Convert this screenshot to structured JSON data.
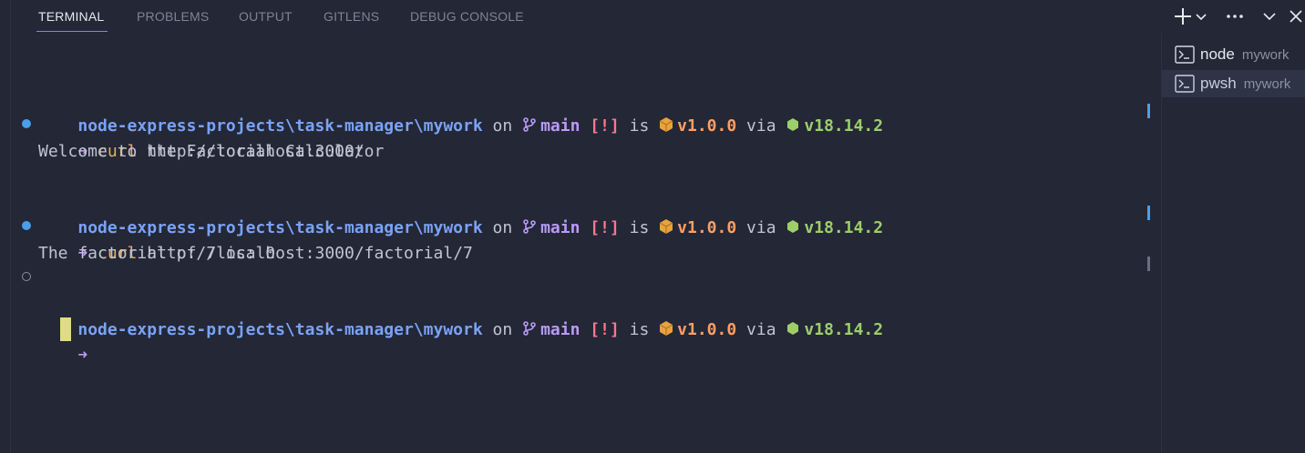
{
  "tabs": [
    {
      "label": "TERMINAL",
      "active": true
    },
    {
      "label": "PROBLEMS",
      "active": false
    },
    {
      "label": "OUTPUT",
      "active": false
    },
    {
      "label": "GITLENS",
      "active": false
    },
    {
      "label": "DEBUG CONSOLE",
      "active": false
    }
  ],
  "actions": [
    "plus-icon",
    "chevron-down-icon",
    "ellipsis-icon",
    "chevron-down-icon",
    "close-icon"
  ],
  "prompt": {
    "path": "node-express-projects\\task-manager\\mywork",
    "on": "on",
    "branch": "main",
    "flag": "[!]",
    "is": "is",
    "version": "v1.0.0",
    "via": "via",
    "node_version": "v18.14.2",
    "arrow": "➜"
  },
  "commands": [
    {
      "cmd": "curl",
      "arg": "http://localhost:3000/",
      "output": "Welcome to the Factorial Calculator"
    },
    {
      "cmd": "curl",
      "arg": "http://localhost:3000/factorial/7",
      "output": "The factorial of 7 is: 0"
    }
  ],
  "terminals": [
    {
      "name": "node",
      "desc": "mywork",
      "selected": false
    },
    {
      "name": "pwsh",
      "desc": "mywork",
      "selected": true
    }
  ],
  "colors": {
    "background": "#232736",
    "path": "#7aa2f7",
    "branch": "#bb9af7",
    "flag": "#f7768e",
    "version": "#ff9e64",
    "node": "#9ece6a",
    "command": "#e0af68",
    "accent": "#8b7cf6"
  }
}
